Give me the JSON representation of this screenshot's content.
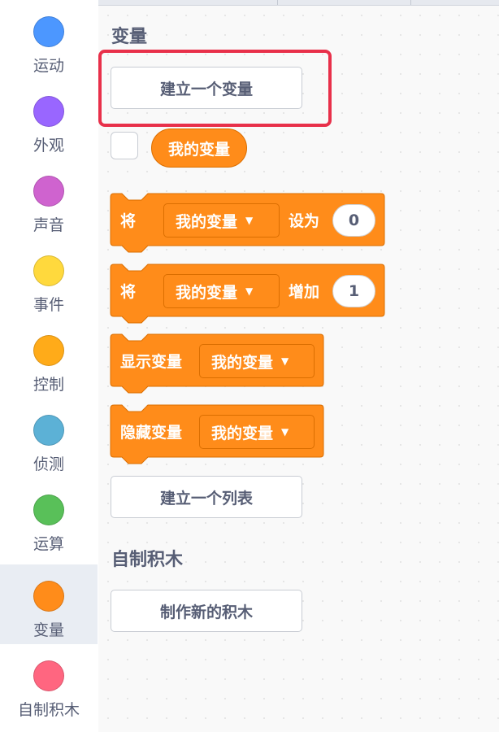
{
  "categories": [
    {
      "label": "运动",
      "color": "#4c97ff"
    },
    {
      "label": "外观",
      "color": "#9966ff"
    },
    {
      "label": "声音",
      "color": "#cf63cf"
    },
    {
      "label": "事件",
      "color": "#ffd93d"
    },
    {
      "label": "控制",
      "color": "#ffab19"
    },
    {
      "label": "侦测",
      "color": "#5cb1d6"
    },
    {
      "label": "运算",
      "color": "#59c059"
    },
    {
      "label": "变量",
      "color": "#ff8c1a"
    },
    {
      "label": "自制积木",
      "color": "#ff6680"
    }
  ],
  "selected_category": "变量",
  "variables": {
    "title": "变量",
    "make_variable": "建立一个变量",
    "variable_reporter": "我的变量",
    "set_block": {
      "prefix": "将",
      "variable": "我的变量",
      "verb": "设为",
      "value": "0"
    },
    "change_block": {
      "prefix": "将",
      "variable": "我的变量",
      "verb": "增加",
      "value": "1"
    },
    "show_block": {
      "label": "显示变量",
      "variable": "我的变量"
    },
    "hide_block": {
      "label": "隐藏变量",
      "variable": "我的变量"
    },
    "make_list": "建立一个列表"
  },
  "my_blocks": {
    "title": "自制积木",
    "make_block": "制作新的积木"
  },
  "colors": {
    "block_fill": "#ff8c1a",
    "block_stroke": "#db6e00",
    "highlight": "#e8304a",
    "text": "#575e75"
  }
}
